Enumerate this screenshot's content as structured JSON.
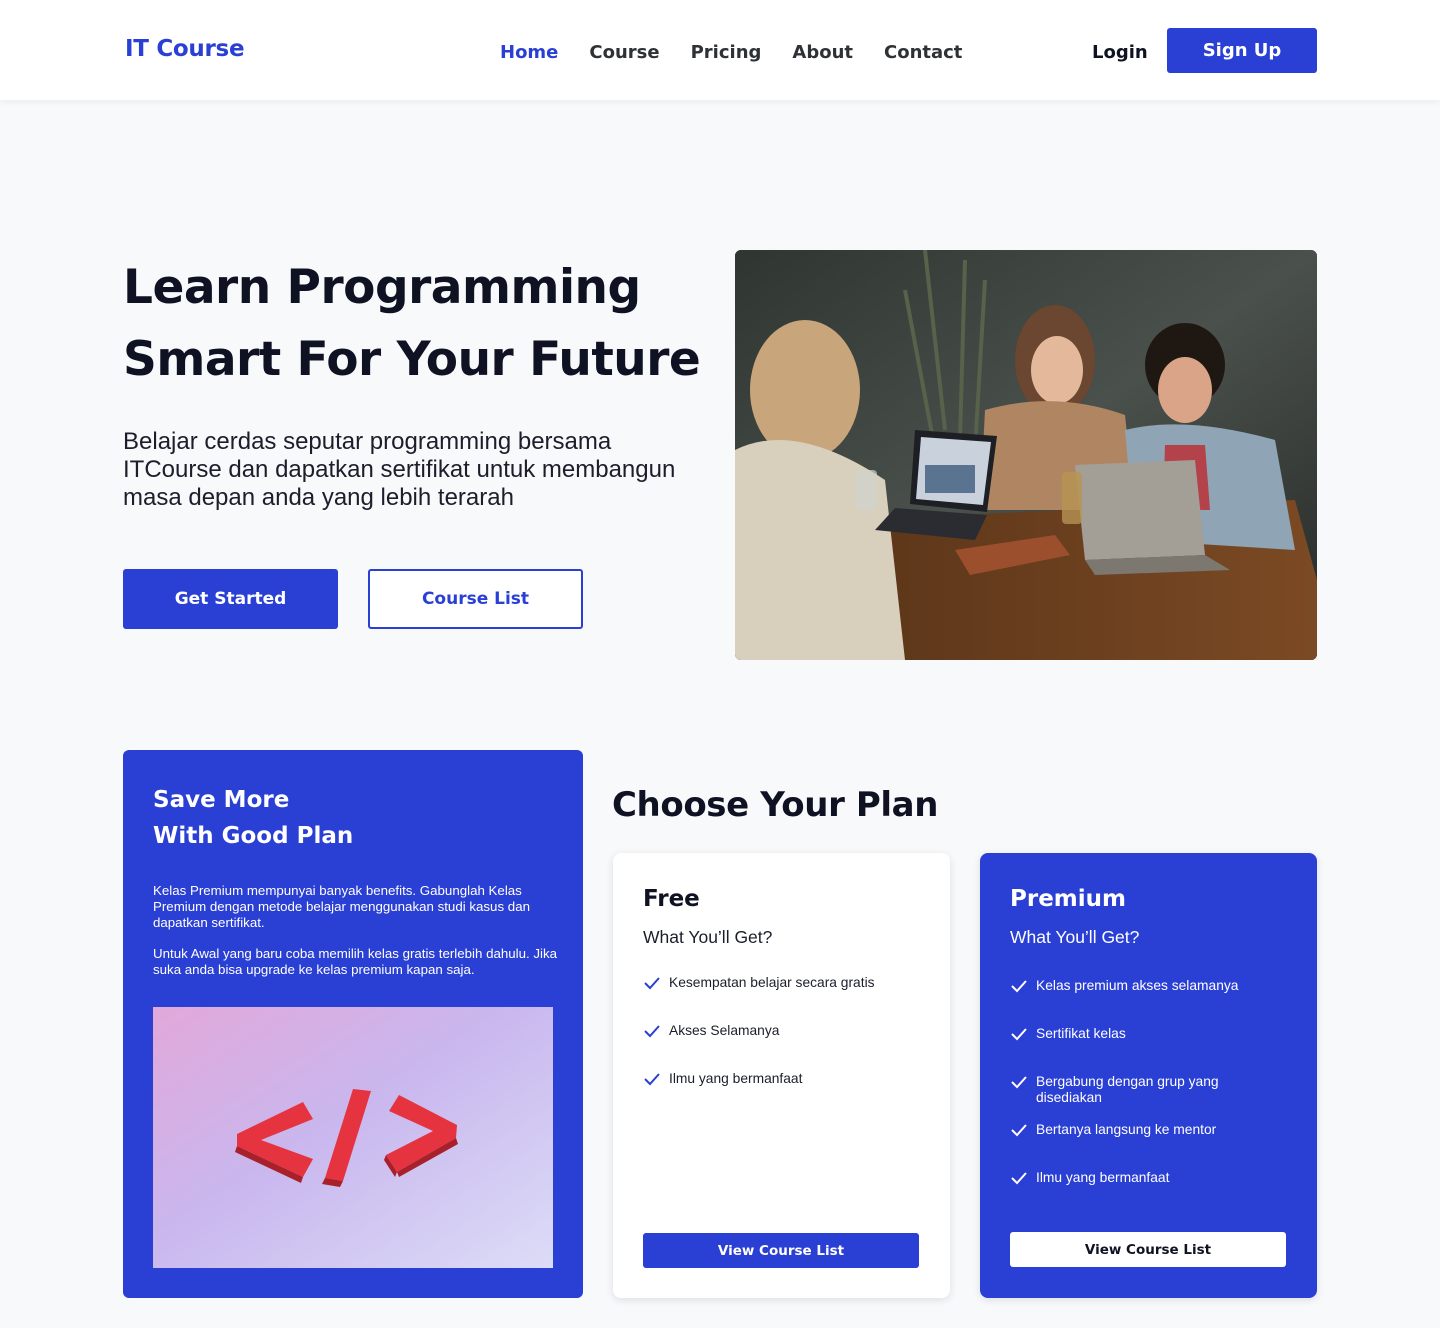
{
  "nav": {
    "logo": "IT Course",
    "links": [
      "Home",
      "Course",
      "Pricing",
      "About",
      "Contact"
    ],
    "active_link": "Home",
    "login_label": "Login",
    "signup_label": "Sign Up"
  },
  "hero": {
    "title_line1": "Learn Programming",
    "title_line2": "Smart For Your Future",
    "subtitle": "Belajar cerdas seputar programming bersama ITCourse dan dapatkan sertifikat untuk membangun masa depan anda yang lebih terarah",
    "primary_button": "Get Started",
    "secondary_button": "Course List"
  },
  "save_card": {
    "title_line1": "Save More",
    "title_line2": "With Good Plan",
    "paragraph1": "Kelas Premium mempunyai banyak benefits. Gabunglah Kelas Premium dengan metode belajar menggunakan studi kasus dan dapatkan sertifikat.",
    "paragraph2": "Untuk Awal yang baru coba memilih kelas gratis terlebih dahulu. Jika suka anda bisa upgrade ke kelas premium kapan saja."
  },
  "plans": {
    "heading": "Choose Your Plan",
    "free": {
      "name": "Free",
      "subtitle": "What You’ll Get?",
      "features": [
        "Kesempatan belajar secara gratis",
        "Akses Selamanya",
        "Ilmu yang bermanfaat"
      ],
      "button": "View Course List"
    },
    "premium": {
      "name": "Premium",
      "subtitle": "What You’ll Get?",
      "features": [
        "Kelas premium akses selamanya",
        "Sertifikat kelas",
        "Bergabung dengan grup yang disediakan",
        "Bertanya langsung ke mentor",
        "Ilmu yang bermanfaat"
      ],
      "button": "View Course List"
    }
  },
  "colors": {
    "accent": "#2a3fd4",
    "background": "#f8f9fb",
    "text": "#0f1222"
  }
}
